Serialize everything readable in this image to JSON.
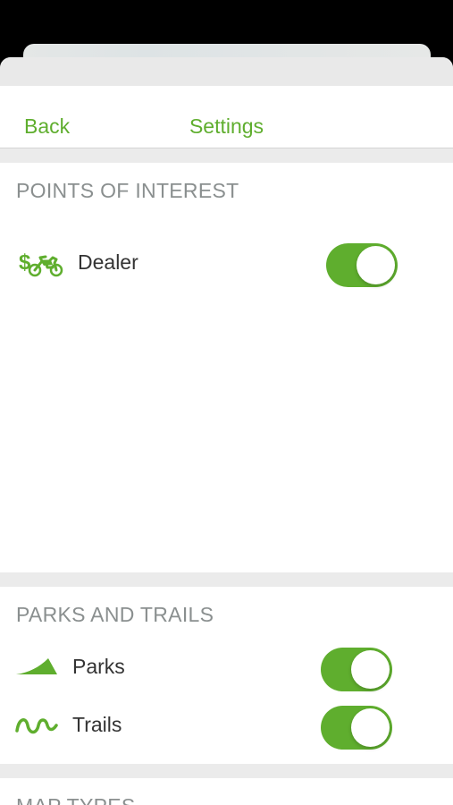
{
  "colors": {
    "accent": "#5fae2e",
    "section_header": "#8a8f8f",
    "background_group": "#ebebeb"
  },
  "navbar": {
    "back_label": "Back",
    "title": "Settings"
  },
  "sections": [
    {
      "header": "POINTS OF INTEREST",
      "items": [
        {
          "label": "Dealer",
          "icon": "dealer-motorcycle-icon",
          "enabled": true
        }
      ]
    },
    {
      "header": "PARKS AND TRAILS",
      "items": [
        {
          "label": "Parks",
          "icon": "park-hill-icon",
          "enabled": true
        },
        {
          "label": "Trails",
          "icon": "trail-squiggle-icon",
          "enabled": true
        }
      ]
    },
    {
      "header": "MAP TYPES",
      "items": []
    }
  ]
}
